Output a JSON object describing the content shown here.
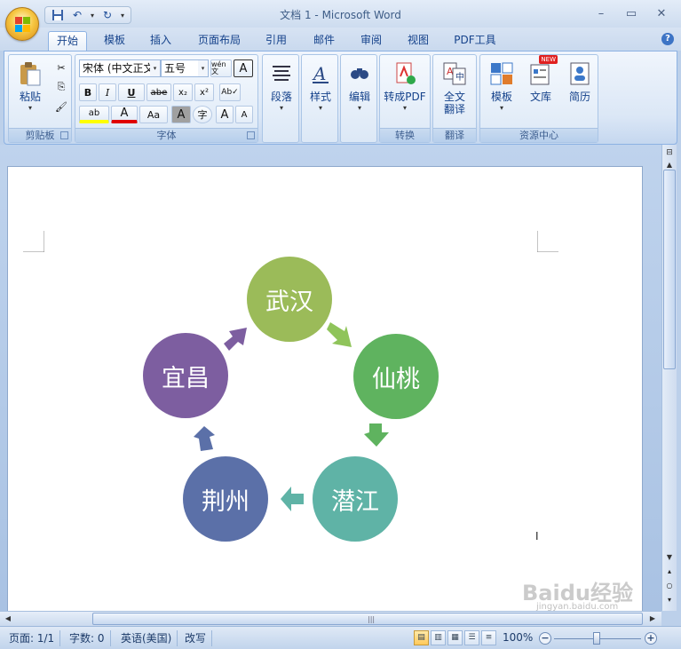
{
  "window": {
    "title": "文档 1 - Microsoft Word"
  },
  "tabs": [
    {
      "label": "开始",
      "active": true
    },
    {
      "label": "模板"
    },
    {
      "label": "插入"
    },
    {
      "label": "页面布局"
    },
    {
      "label": "引用"
    },
    {
      "label": "邮件"
    },
    {
      "label": "审阅"
    },
    {
      "label": "视图"
    },
    {
      "label": "PDF工具"
    }
  ],
  "ribbon": {
    "clipboard": {
      "group_label": "剪贴板",
      "paste_label": "粘贴"
    },
    "font": {
      "group_label": "字体",
      "font_name": "宋体 (中文正文",
      "font_size": "五号",
      "bold": "B",
      "italic": "I",
      "underline": "U",
      "strike": "abe",
      "subscript": "x₂",
      "superscript": "x²",
      "highlight": "ab",
      "font_color": "A",
      "change_case": "Aa",
      "char_shading": "A",
      "enclose": "字",
      "grow": "A",
      "shrink": "A",
      "phonetic": "wén 文",
      "border_char": "A"
    },
    "paragraph": {
      "label": "段落"
    },
    "styles": {
      "label": "样式"
    },
    "editing": {
      "label": "编辑"
    },
    "convert": {
      "group_label": "转换",
      "to_pdf_label": "转成PDF"
    },
    "translate": {
      "group_label": "翻译",
      "full_translate_label": "全文\n翻译"
    },
    "resources": {
      "group_label": "资源中心",
      "template_label": "模板",
      "library_label": "文库",
      "resume_label": "简历",
      "new_badge": "NEW"
    }
  },
  "diagram": {
    "nodes": [
      {
        "label": "武汉",
        "color": "#9bbb59"
      },
      {
        "label": "仙桃",
        "color": "#5fb35f"
      },
      {
        "label": "潜江",
        "color": "#5fb3a6"
      },
      {
        "label": "荆州",
        "color": "#5b70a8"
      },
      {
        "label": "宜昌",
        "color": "#7d5ea0"
      }
    ]
  },
  "status": {
    "page": "页面: 1/1",
    "words": "字数: 0",
    "language": "英语(美国)",
    "mode": "改写",
    "zoom": "100%"
  },
  "watermark": {
    "text": "Baidu经验",
    "url": "jingyan.baidu.com"
  }
}
